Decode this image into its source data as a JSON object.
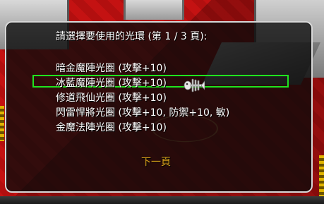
{
  "dialog": {
    "title": "請選擇要使用的光環 (第 1 / 3 頁):",
    "options": [
      {
        "label": "暗金魔陣光圈 (攻擊+10)"
      },
      {
        "label": "冰藍魔陣光圈 (攻擊+10)"
      },
      {
        "label": "修道飛仙光圈 (攻擊+10)"
      },
      {
        "label": "閃雷悍將光圈 (攻擊+10, 防禦+10, 敏)"
      },
      {
        "label": "金魔法陣光圈 (攻擊+10)"
      }
    ],
    "selected_index": 1,
    "next_page_label": "下一頁"
  },
  "colors": {
    "highlight_border": "#1fe41f",
    "next_page_text": "#d9a21a",
    "dialog_border": "#d8d8d8",
    "floor_red": "#c41212"
  },
  "icons": {
    "cursor": "fish-bone-cursor-icon"
  }
}
